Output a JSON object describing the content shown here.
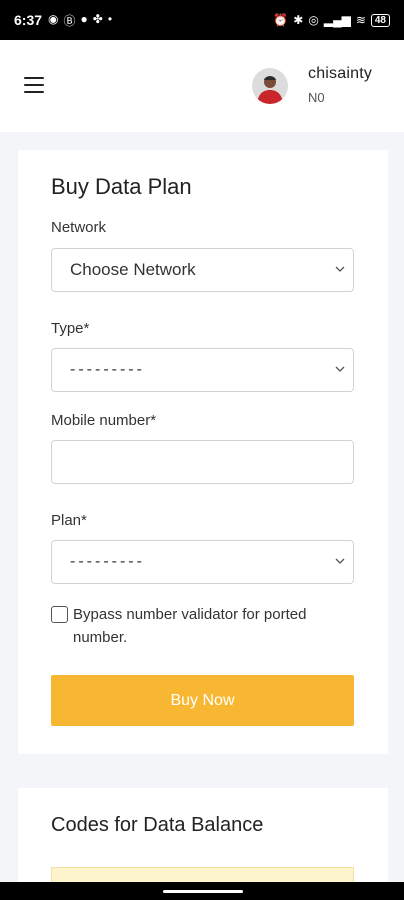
{
  "status_bar": {
    "time": "6:37",
    "left_icons": [
      "whatsapp-icon",
      "b-icon",
      "messenger-icon",
      "slack-icon",
      "dot-icon"
    ],
    "right_icons": [
      "alarm-icon",
      "bluetooth-icon",
      "nfc-icon",
      "signal-icon",
      "wifi-icon"
    ],
    "battery": "48"
  },
  "header": {
    "username": "chisainty",
    "balance": "N0"
  },
  "form": {
    "title": "Buy Data Plan",
    "network_label": "Network",
    "network_value": "Choose Network",
    "type_label": "Type*",
    "type_value": "---------",
    "mobile_label": "Mobile number*",
    "mobile_value": "",
    "plan_label": "Plan*",
    "plan_value": "---------",
    "bypass_label": "Bypass number validator for ported number.",
    "bypass_checked": false,
    "buy_button": "Buy Now"
  },
  "codes": {
    "title": "Codes for Data Balance"
  },
  "colors": {
    "accent": "#f7b733",
    "codes_box": "#fdf3cc"
  }
}
